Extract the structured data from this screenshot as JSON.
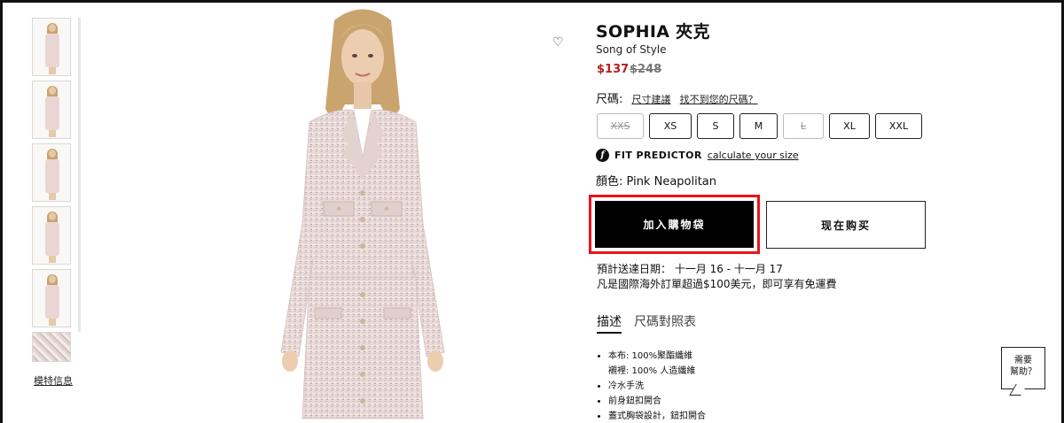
{
  "product": {
    "title": "SOPHIA 夾克",
    "brand": "Song of Style",
    "sale_price": "$137",
    "original_price": "$248",
    "color_label": "顏色:",
    "color_value": "Pink Neapolitan"
  },
  "size_section": {
    "label": "尺碼:",
    "size_guide_link": "尺寸建議",
    "cant_find_link": "找不到您的尺碼？",
    "sizes": [
      {
        "label": "XXS",
        "available": false
      },
      {
        "label": "XS",
        "available": true
      },
      {
        "label": "S",
        "available": true
      },
      {
        "label": "M",
        "available": true
      },
      {
        "label": "L",
        "available": false
      },
      {
        "label": "XL",
        "available": true
      },
      {
        "label": "XXL",
        "available": true
      }
    ]
  },
  "fit_predictor": {
    "icon": "fit-predictor-icon",
    "label": "FIT PREDICTOR",
    "link": "calculate your size"
  },
  "actions": {
    "add_to_bag": "加入購物袋",
    "buy_now": "现在购买"
  },
  "shipping": {
    "estimate": "預計送達日期： 十一月 16 - 十一月 17",
    "free_shipping": "凡是國際海外訂單超過$100美元，即可享有免運費"
  },
  "tabs": [
    {
      "label": "描述",
      "active": true
    },
    {
      "label": "尺碼對照表",
      "active": false
    }
  ],
  "description": [
    "本布: 100%聚酯纖維",
    "襯裡: 100% 人造纖維",
    "冷水手洗",
    "前身鈕扣開合",
    "蓋式胸袋設計，鈕扣開合"
  ],
  "gallery": {
    "thumbnails": [
      "front-view",
      "front-close",
      "side-view",
      "back-view",
      "full-length",
      "fabric-swatch"
    ],
    "model_info_link": "模特信息"
  },
  "help_bubble": {
    "line1": "需要",
    "line2": "幫助？"
  },
  "colors": {
    "sale_red": "#b41f1f",
    "highlight_red": "#e8141b",
    "primary_black": "#000000"
  }
}
